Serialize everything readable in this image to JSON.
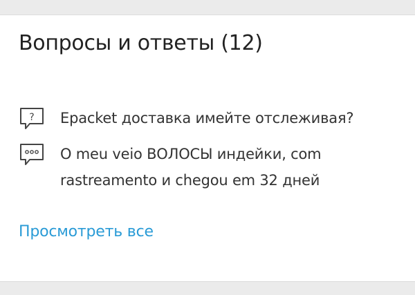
{
  "section": {
    "title": "Вопросы и ответы (12)"
  },
  "questions": [
    {
      "icon": "question-bubble-icon",
      "text": "Epacket доставка имейте отслеживая?"
    },
    {
      "icon": "answer-dots-bubble-icon",
      "text": "O meu veio ВОЛОСЫ индейки, com rastreamento и chegou em 32 дней"
    }
  ],
  "actions": {
    "view_all_label": "Просмотреть все"
  },
  "colors": {
    "link": "#2a9bd6",
    "text": "#333333",
    "background": "#ebebeb",
    "card": "#ffffff"
  }
}
